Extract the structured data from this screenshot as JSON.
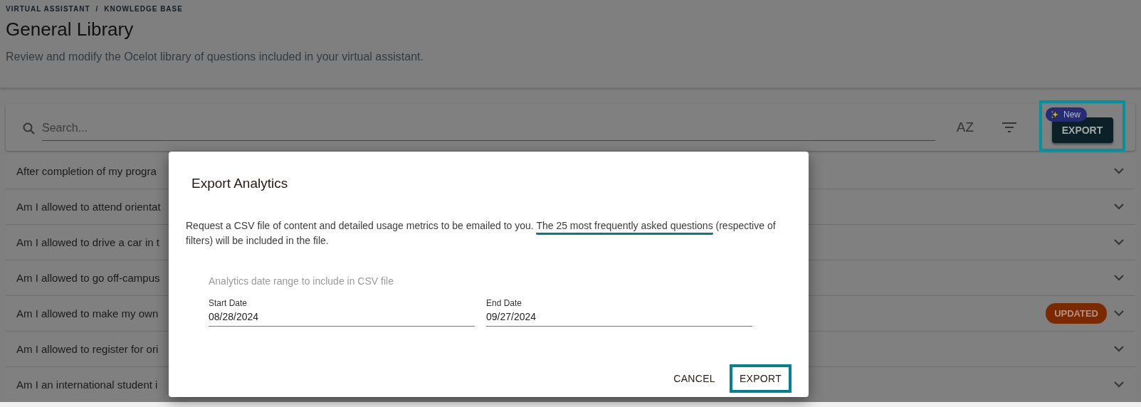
{
  "breadcrumb": {
    "items": [
      "VIRTUAL ASSISTANT",
      "KNOWLEDGE BASE"
    ],
    "separator": "/"
  },
  "title": "General Library",
  "subtitle": "Review and modify the Ocelot library of questions included in your virtual assistant.",
  "toolbar": {
    "search": {
      "placeholder": "Search..."
    },
    "sort_button": {
      "label": "AZ"
    },
    "export_button": {
      "label": "EXPORT",
      "badge": "New",
      "highlighted": true
    }
  },
  "questions": [
    {
      "text": "After completion of my progra"
    },
    {
      "text": "Am I allowed to attend orientat"
    },
    {
      "text": "Am I allowed to drive a car in t"
    },
    {
      "text": "Am I allowed to go off-campus"
    },
    {
      "text": "Am I allowed to make my own",
      "badge": "UPDATED"
    },
    {
      "text": "Am I allowed to register for ori"
    },
    {
      "text": "Am I an international student i"
    }
  ],
  "dialog": {
    "title": "Export Analytics",
    "description": [
      {
        "text": "Request a CSV file of content and detailed usage metrics to be emailed to you. ",
        "highlighted": false
      },
      {
        "text": "The 25 most frequently asked questions",
        "highlighted": true
      },
      {
        "text": " (respective of filters) will be included in the file.",
        "highlighted": false
      }
    ],
    "date_range": {
      "label": "Analytics date range to include in CSV file",
      "fields": [
        {
          "label": "Start Date",
          "value": "08/28/2024"
        },
        {
          "label": "End Date",
          "value": "09/27/2024"
        }
      ]
    },
    "actions": [
      {
        "label": "CANCEL",
        "highlighted": false
      },
      {
        "label": "EXPORT",
        "highlighted": true
      }
    ]
  }
}
